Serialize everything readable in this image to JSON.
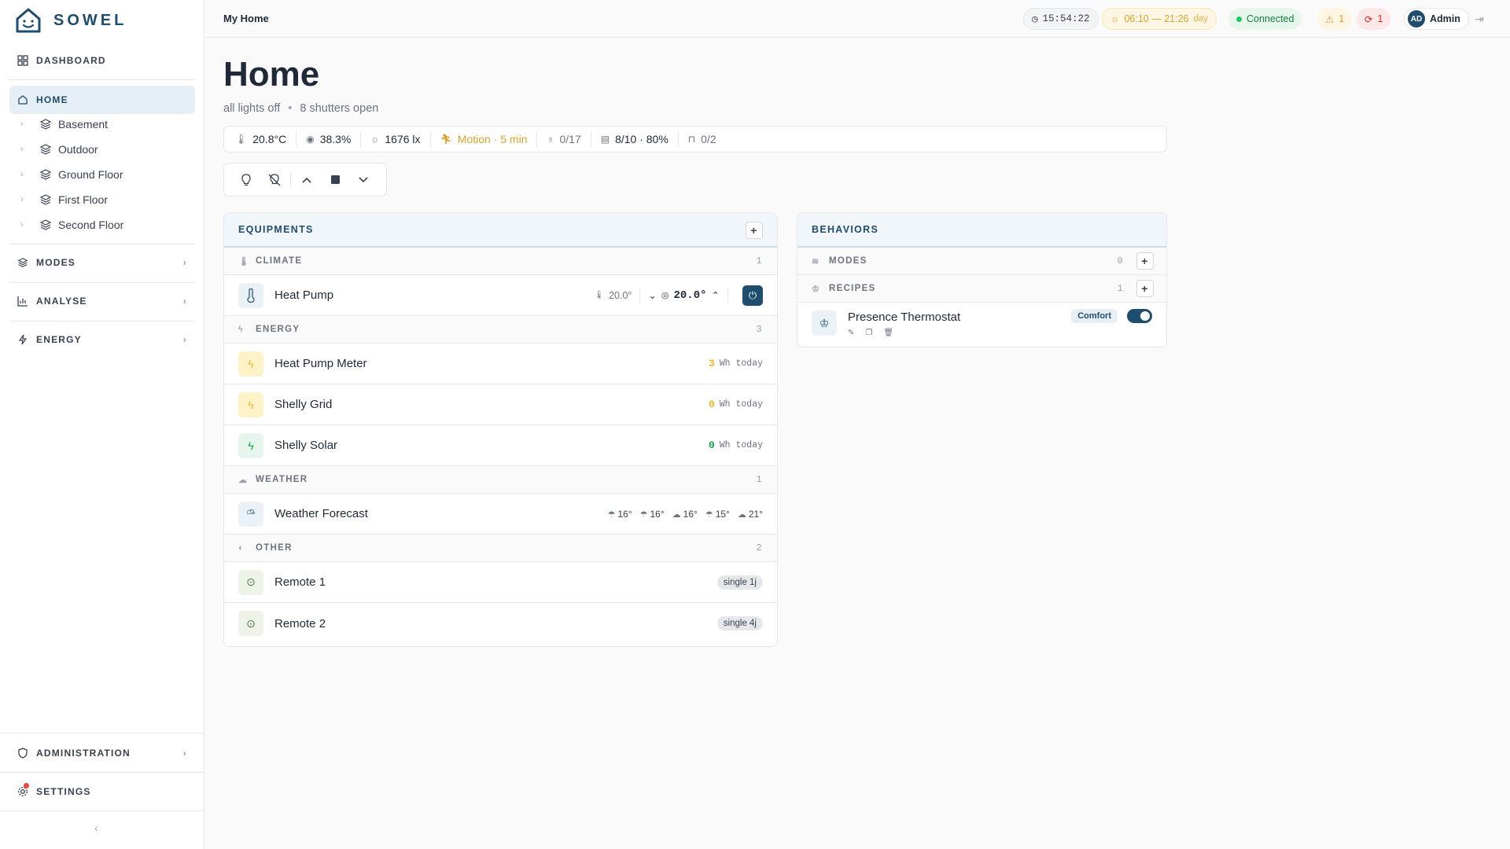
{
  "app": {
    "logo_text": "SOWEL"
  },
  "sidebar": {
    "dashboard": "DASHBOARD",
    "home": "HOME",
    "floors": [
      "Basement",
      "Outdoor",
      "Ground Floor",
      "First Floor",
      "Second Floor"
    ],
    "modes": "MODES",
    "analyse": "ANALYSE",
    "energy": "ENERGY",
    "administration": "ADMINISTRATION",
    "settings": "SETTINGS"
  },
  "topbar": {
    "breadcrumb": "My Home",
    "time": "15:54:22",
    "sun_range": "06:10 — 21:26",
    "sun_phase": "day",
    "connection": "Connected",
    "warnings": "1",
    "errors": "1",
    "user_initials": "AD",
    "user_name": "Admin"
  },
  "page": {
    "title": "Home",
    "sub_lights": "all lights off",
    "sub_sep": "•",
    "sub_shutters": "8 shutters open"
  },
  "stats": {
    "temperature": "20.8°C",
    "humidity": "38.3%",
    "luminosity": "1676 lx",
    "motion": "Motion · 5 min",
    "lights": "0/17",
    "shutters": "8/10 · 80%",
    "seats": "0/2"
  },
  "equipments": {
    "header": "EQUIPMENTS",
    "groups": {
      "climate": {
        "label": "CLIMATE",
        "count": "1"
      },
      "energy": {
        "label": "ENERGY",
        "count": "3"
      },
      "weather": {
        "label": "WEATHER",
        "count": "1"
      },
      "other": {
        "label": "OTHER",
        "count": "2"
      }
    },
    "heat_pump": {
      "name": "Heat Pump",
      "current": "20.0°",
      "target": "20.0°"
    },
    "energy_items": [
      {
        "name": "Heat Pump Meter",
        "value": "3",
        "unit": "Wh today",
        "color": "#f0b429"
      },
      {
        "name": "Shelly Grid",
        "value": "0",
        "unit": "Wh today",
        "color": "#f0b429"
      },
      {
        "name": "Shelly Solar",
        "value": "0",
        "unit": "Wh today",
        "color": "#16a34a"
      }
    ],
    "weather": {
      "name": "Weather Forecast",
      "forecast": [
        "16°",
        "16°",
        "16°",
        "15°",
        "21°"
      ]
    },
    "remotes": [
      {
        "name": "Remote 1",
        "chip": "single 1j"
      },
      {
        "name": "Remote 2",
        "chip": "single 4j"
      }
    ]
  },
  "behaviors": {
    "header": "BEHAVIORS",
    "modes": {
      "label": "MODES",
      "count": "0"
    },
    "recipes": {
      "label": "RECIPES",
      "count": "1"
    },
    "recipe_items": [
      {
        "name": "Presence Thermostat",
        "tag": "Comfort",
        "enabled": true
      }
    ]
  },
  "colors": {
    "brand": "#1e4d6e",
    "warning": "#d9a32a",
    "success": "#16a34a",
    "danger": "#dc2626"
  }
}
